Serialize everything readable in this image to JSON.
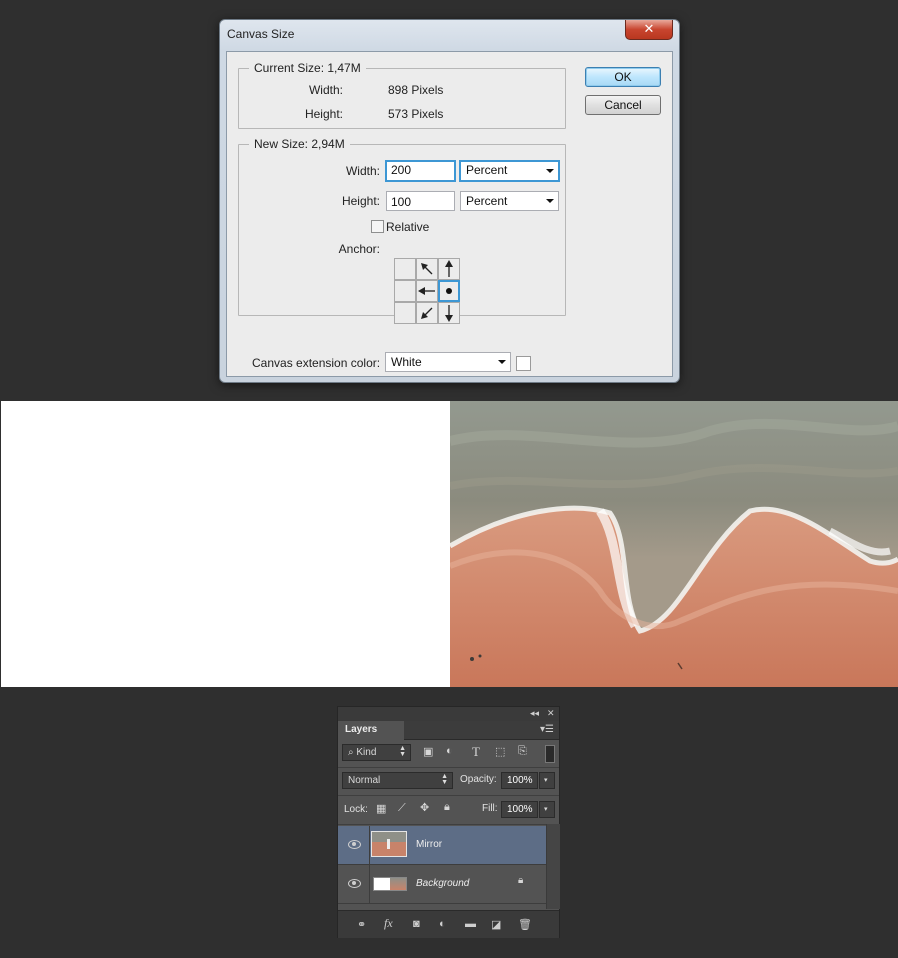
{
  "dialog": {
    "title": "Canvas Size",
    "close_label": "✕",
    "current_size": {
      "legend": "Current Size: 1,47M",
      "width_label": "Width:",
      "width_value": "898 Pixels",
      "height_label": "Height:",
      "height_value": "573 Pixels"
    },
    "new_size": {
      "legend": "New Size: 2,94M",
      "width_label": "Width:",
      "width_value": "200",
      "width_unit": "Percent",
      "height_label": "Height:",
      "height_value": "100",
      "height_unit": "Percent",
      "relative_label": "Relative",
      "relative_checked": false,
      "anchor_label": "Anchor:"
    },
    "extension_label": "Canvas extension color:",
    "extension_value": "White",
    "extension_swatch": "#ffffff",
    "ok_label": "OK",
    "cancel_label": "Cancel"
  },
  "layers_panel": {
    "tab": "Layers",
    "filter_kind": "Kind",
    "blend_mode": "Normal",
    "opacity_label": "Opacity:",
    "opacity_value": "100%",
    "lock_label": "Lock:",
    "fill_label": "Fill:",
    "fill_value": "100%",
    "layers": [
      {
        "name": "Mirror",
        "selected": true,
        "visible": true
      },
      {
        "name": "Background",
        "selected": false,
        "visible": true,
        "locked": true
      }
    ],
    "bottom_icons": [
      "link-icon",
      "fx-icon",
      "mask-icon",
      "adjustment-icon",
      "folder-icon",
      "new-layer-icon",
      "trash-icon"
    ]
  },
  "colors": {
    "accent": "#3d97d4",
    "selected_layer": "#5d6d86",
    "background": "#2f2f2f"
  }
}
